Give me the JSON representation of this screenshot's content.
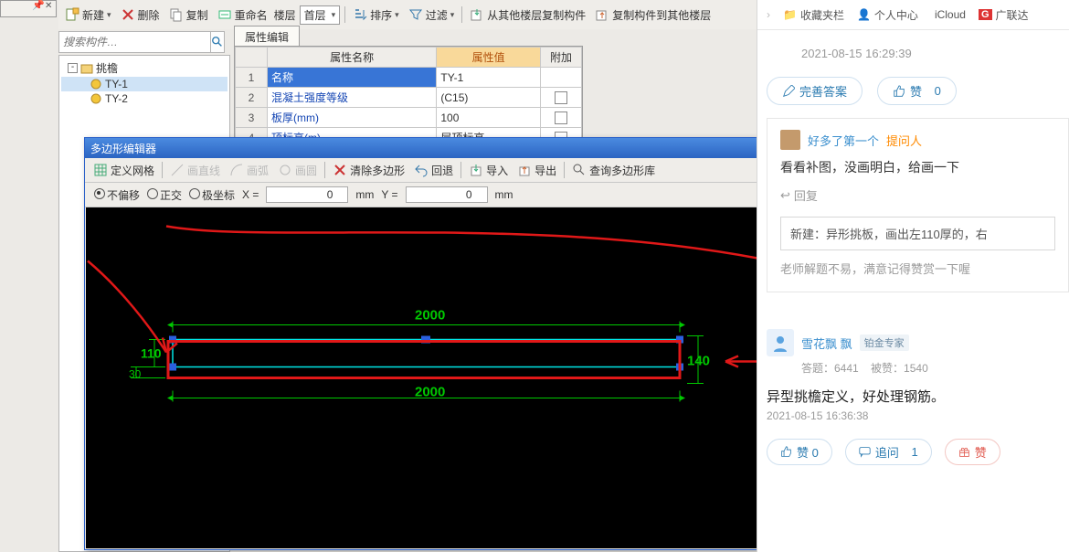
{
  "toolbar": {
    "new": "新建",
    "delete": "删除",
    "copy": "复制",
    "rename": "重命名",
    "floor_label": "楼层",
    "floor_value": "首层",
    "sort": "排序",
    "filter": "过滤",
    "copy_from": "从其他楼层复制构件",
    "copy_to": "复制构件到其他楼层"
  },
  "search": {
    "placeholder": "搜索构件…"
  },
  "tree": {
    "root": "挑檐",
    "items": [
      "TY-1",
      "TY-2"
    ]
  },
  "prop": {
    "tab": "属性编辑",
    "head_name": "属性名称",
    "head_value": "属性值",
    "head_extra": "附加",
    "rows": [
      {
        "n": "1",
        "name": "名称",
        "value": "TY-1"
      },
      {
        "n": "2",
        "name": "混凝土强度等级",
        "value": "(C15)"
      },
      {
        "n": "3",
        "name": "板厚(mm)",
        "value": "100"
      },
      {
        "n": "4",
        "name": "顶标高(m)",
        "value": "层顶标高"
      }
    ]
  },
  "poly": {
    "title": "多边形编辑器",
    "tb": {
      "grid": "定义网格",
      "line": "画直线",
      "arc": "画弧",
      "circle": "画圆",
      "clear": "清除多边形",
      "undo": "回退",
      "import": "导入",
      "export": "导出",
      "query": "查询多边形库"
    },
    "opt": {
      "nooffset": "不偏移",
      "ortho": "正交",
      "polar": "极坐标",
      "x_label": "X =",
      "x_val": "0",
      "y_label": "Y =",
      "y_val": "0",
      "unit": "mm"
    },
    "dims": {
      "top": "2000",
      "bottom": "2000",
      "left_big": "110",
      "left_small": "30",
      "right": "140"
    }
  },
  "web": {
    "bookmarks": {
      "fav": "收藏夹栏",
      "personal": "个人中心",
      "icloud": "iCloud",
      "gld": "广联达"
    },
    "ts1": "2021-08-15 16:29:39",
    "improve": "完善答案",
    "like": "赞",
    "like_n": "0",
    "ans1": {
      "name": "好多了第一个",
      "tag": "提问人",
      "body": "看看补图，没画明白，给画一下",
      "reply": "回复",
      "quote": "新建：异形挑板，画出左110厚的，右",
      "note": "老师解题不易，满意记得赞赏一下喔"
    },
    "ans2": {
      "name": "雪花飘 飘",
      "badge": "铂金专家",
      "stat_a": "答题：6441",
      "stat_b": "被赞：1540",
      "body": "异型挑檐定义，好处理钢筋。",
      "ts": "2021-08-15 16:36:38",
      "like": "赞 0",
      "ask": "追问",
      "ask_n": "1",
      "tip": "赞"
    }
  }
}
